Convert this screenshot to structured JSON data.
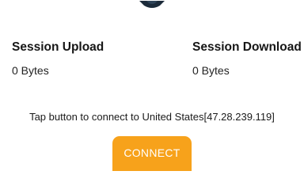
{
  "header": {
    "logo_icon": "shield-icon",
    "logo_color": "#1c2b3a"
  },
  "stats": {
    "upload": {
      "title": "Session Upload",
      "value": "0 Bytes"
    },
    "download": {
      "title": "Session Download",
      "value": "0 Bytes"
    }
  },
  "connect": {
    "hint": "Tap button to connect to United States[47.28.239.119]",
    "button_label": "CONNECT",
    "button_color": "#f7a21b"
  }
}
